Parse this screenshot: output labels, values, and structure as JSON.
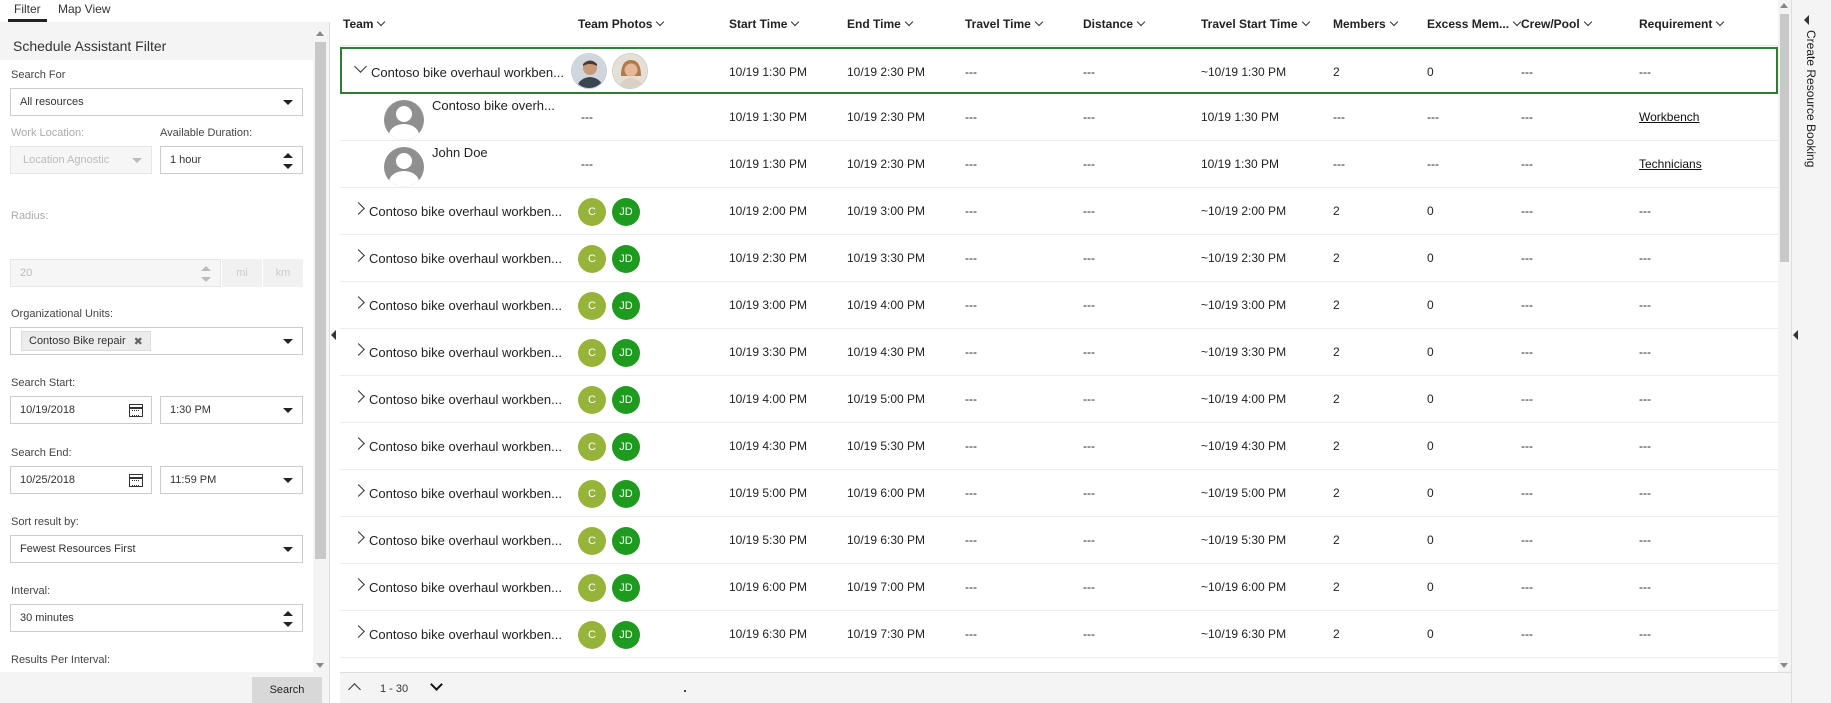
{
  "tabs": [
    "Filter",
    "Map View"
  ],
  "filter": {
    "title": "Schedule Assistant Filter",
    "search_for_label": "Search For",
    "search_for_value": "All resources",
    "work_location_label": "Work Location:",
    "work_location_value": "Location Agnostic",
    "available_duration_label": "Available Duration:",
    "available_duration_value": "1 hour",
    "radius_label": "Radius:",
    "radius_value": "20",
    "radius_unit_mi": "mi",
    "radius_unit_km": "km",
    "org_units_label": "Organizational Units:",
    "org_units_chip": "Contoso Bike repair",
    "search_start_label": "Search Start:",
    "search_start_date": "10/19/2018",
    "search_start_time": "1:30 PM",
    "search_end_label": "Search End:",
    "search_end_date": "10/25/2018",
    "search_end_time": "11:59 PM",
    "sort_label": "Sort result by:",
    "sort_value": "Fewest Resources First",
    "interval_label": "Interval:",
    "interval_value": "30 minutes",
    "results_per_interval_label": "Results Per Interval:",
    "search_button": "Search"
  },
  "columns": [
    "Team",
    "Team Photos",
    "Start Time",
    "End Time",
    "Travel Time",
    "Distance",
    "Travel Start Time",
    "Members",
    "Excess Mem...",
    "Crew/Pool",
    "Requirement"
  ],
  "selected_row": {
    "team": "Contoso bike overhaul workben...",
    "start": "10/19 1:30 PM",
    "end": "10/19 2:30 PM",
    "travel_time": "---",
    "distance": "---",
    "travel_start": "~10/19 1:30 PM",
    "members": "2",
    "excess": "0",
    "crew": "---",
    "requirement": "---"
  },
  "sub_rows": [
    {
      "name": "Contoso bike overh...",
      "photos": "---",
      "start": "10/19 1:30 PM",
      "end": "10/19 2:30 PM",
      "travel_time": "---",
      "distance": "---",
      "travel_start": "10/19 1:30 PM",
      "members": "---",
      "excess": "---",
      "crew": "---",
      "requirement": "Workbench"
    },
    {
      "name": "John Doe",
      "photos": "---",
      "start": "10/19 1:30 PM",
      "end": "10/19 2:30 PM",
      "travel_time": "---",
      "distance": "---",
      "travel_start": "10/19 1:30 PM",
      "members": "---",
      "excess": "---",
      "crew": "---",
      "requirement": "Technicians"
    }
  ],
  "avatar_initials": {
    "c": "C",
    "jd": "JD"
  },
  "rows": [
    {
      "team": "Contoso bike overhaul workben...",
      "start": "10/19 2:00 PM",
      "end": "10/19 3:00 PM",
      "travel_time": "---",
      "distance": "---",
      "travel_start": "~10/19 2:00 PM",
      "members": "2",
      "excess": "0",
      "crew": "---",
      "requirement": "---"
    },
    {
      "team": "Contoso bike overhaul workben...",
      "start": "10/19 2:30 PM",
      "end": "10/19 3:30 PM",
      "travel_time": "---",
      "distance": "---",
      "travel_start": "~10/19 2:30 PM",
      "members": "2",
      "excess": "0",
      "crew": "---",
      "requirement": "---"
    },
    {
      "team": "Contoso bike overhaul workben...",
      "start": "10/19 3:00 PM",
      "end": "10/19 4:00 PM",
      "travel_time": "---",
      "distance": "---",
      "travel_start": "~10/19 3:00 PM",
      "members": "2",
      "excess": "0",
      "crew": "---",
      "requirement": "---"
    },
    {
      "team": "Contoso bike overhaul workben...",
      "start": "10/19 3:30 PM",
      "end": "10/19 4:30 PM",
      "travel_time": "---",
      "distance": "---",
      "travel_start": "~10/19 3:30 PM",
      "members": "2",
      "excess": "0",
      "crew": "---",
      "requirement": "---"
    },
    {
      "team": "Contoso bike overhaul workben...",
      "start": "10/19 4:00 PM",
      "end": "10/19 5:00 PM",
      "travel_time": "---",
      "distance": "---",
      "travel_start": "~10/19 4:00 PM",
      "members": "2",
      "excess": "0",
      "crew": "---",
      "requirement": "---"
    },
    {
      "team": "Contoso bike overhaul workben...",
      "start": "10/19 4:30 PM",
      "end": "10/19 5:30 PM",
      "travel_time": "---",
      "distance": "---",
      "travel_start": "~10/19 4:30 PM",
      "members": "2",
      "excess": "0",
      "crew": "---",
      "requirement": "---"
    },
    {
      "team": "Contoso bike overhaul workben...",
      "start": "10/19 5:00 PM",
      "end": "10/19 6:00 PM",
      "travel_time": "---",
      "distance": "---",
      "travel_start": "~10/19 5:00 PM",
      "members": "2",
      "excess": "0",
      "crew": "---",
      "requirement": "---"
    },
    {
      "team": "Contoso bike overhaul workben...",
      "start": "10/19 5:30 PM",
      "end": "10/19 6:30 PM",
      "travel_time": "---",
      "distance": "---",
      "travel_start": "~10/19 5:30 PM",
      "members": "2",
      "excess": "0",
      "crew": "---",
      "requirement": "---"
    },
    {
      "team": "Contoso bike overhaul workben...",
      "start": "10/19 6:00 PM",
      "end": "10/19 7:00 PM",
      "travel_time": "---",
      "distance": "---",
      "travel_start": "~10/19 6:00 PM",
      "members": "2",
      "excess": "0",
      "crew": "---",
      "requirement": "---"
    },
    {
      "team": "Contoso bike overhaul workben...",
      "start": "10/19 6:30 PM",
      "end": "10/19 7:30 PM",
      "travel_time": "---",
      "distance": "---",
      "travel_start": "~10/19 6:30 PM",
      "members": "2",
      "excess": "0",
      "crew": "---",
      "requirement": "---"
    }
  ],
  "footer": {
    "page_range": "1 - 30"
  },
  "right_panel": {
    "title": "Create Resource Booking"
  },
  "colors": {
    "selected_border": "#2e7d32",
    "avatar_c": "#97b43a",
    "avatar_jd": "#1e9a1e"
  }
}
